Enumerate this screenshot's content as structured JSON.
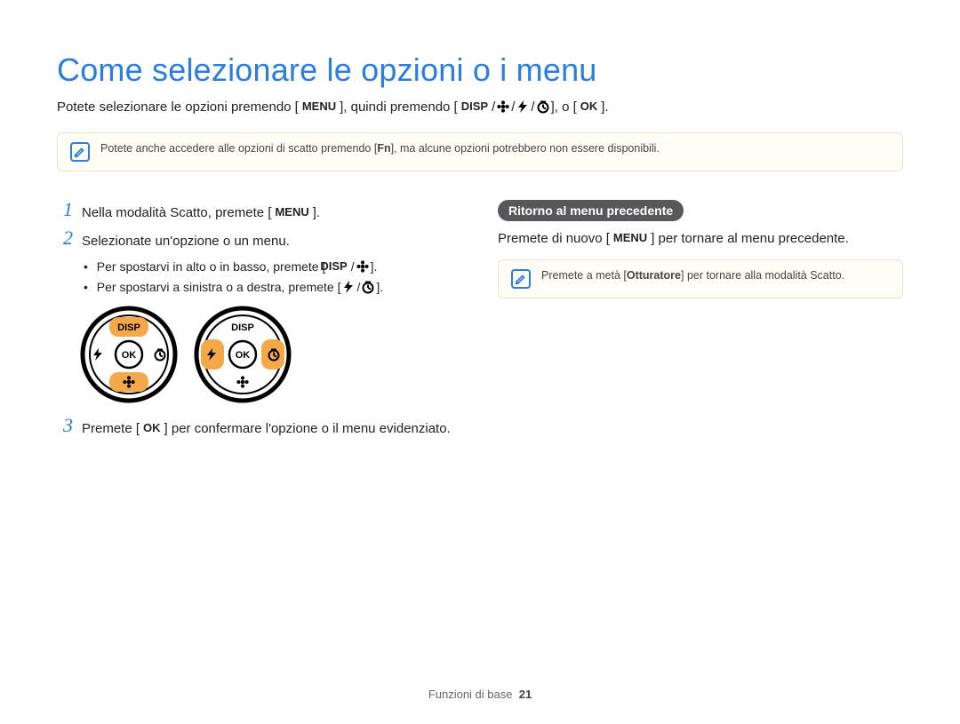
{
  "title": "Come selezionare le opzioni o i menu",
  "intro": {
    "pre": "Potete selezionare le opzioni premendo [",
    "menu": "MENU",
    "mid": "], quindi premendo [",
    "disp": "DISP",
    "end": "], o [",
    "ok": "OK",
    "tail": "]."
  },
  "note1": {
    "pre": "Potete anche accedere alle opzioni di scatto premendo [",
    "fn": "Fn",
    "post": "], ma alcune opzioni potrebbero non essere disponibili."
  },
  "steps": {
    "s1": {
      "num": "1",
      "pre": "Nella modalità Scatto, premete [",
      "menu": "MENU",
      "post": "]."
    },
    "s2": {
      "num": "2",
      "text": "Selezionate un'opzione o un menu.",
      "b1": {
        "pre": "Per spostarvi in alto o in basso, premete [",
        "disp": "DISP",
        "post": "]."
      },
      "b2": {
        "pre": "Per spostarvi a sinistra o a destra, premete [",
        "post": "]."
      }
    },
    "s3": {
      "num": "3",
      "pre": "Premete [",
      "ok": "OK",
      "post": "] per confermare l'opzione o il menu evidenziato."
    }
  },
  "pad": {
    "disp": "DISP",
    "ok": "OK"
  },
  "right": {
    "chip": "Ritorno al menu precedente",
    "para": {
      "pre": "Premete di nuovo [",
      "menu": "MENU",
      "post": "] per tornare al menu precedente."
    },
    "note": {
      "pre": "Premete a metà [",
      "bold": "Otturatore",
      "post": "] per tornare alla modalità Scatto."
    }
  },
  "footer": {
    "section": "Funzioni di base",
    "page": "21"
  }
}
